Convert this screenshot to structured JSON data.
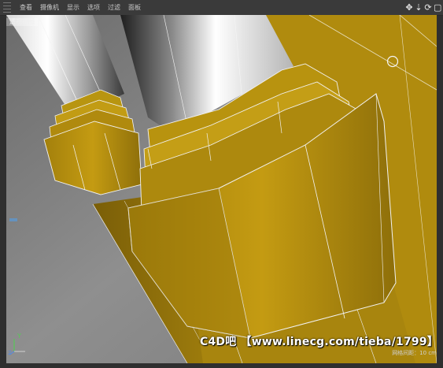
{
  "menu": {
    "items": [
      "查看",
      "摄像机",
      "显示",
      "选项",
      "过滤",
      "面板"
    ]
  },
  "nav_icons": [
    "move-view-icon",
    "dolly-view-icon",
    "rotate-view-icon",
    "maximize-view-icon"
  ],
  "viewport": {
    "camera_label": "透视视图",
    "watermark": "C4D吧 【www.linecg.com/tieba/1799】",
    "grid_readout": "网格间距：10 cm",
    "axis_labels": {
      "y": "Y",
      "z": "Z"
    }
  },
  "colors": {
    "yellow_model": "#b8920f",
    "yellow_dark": "#6e5508",
    "background_grey": "#8a8a8a",
    "wireframe": "#f2f2f2"
  }
}
